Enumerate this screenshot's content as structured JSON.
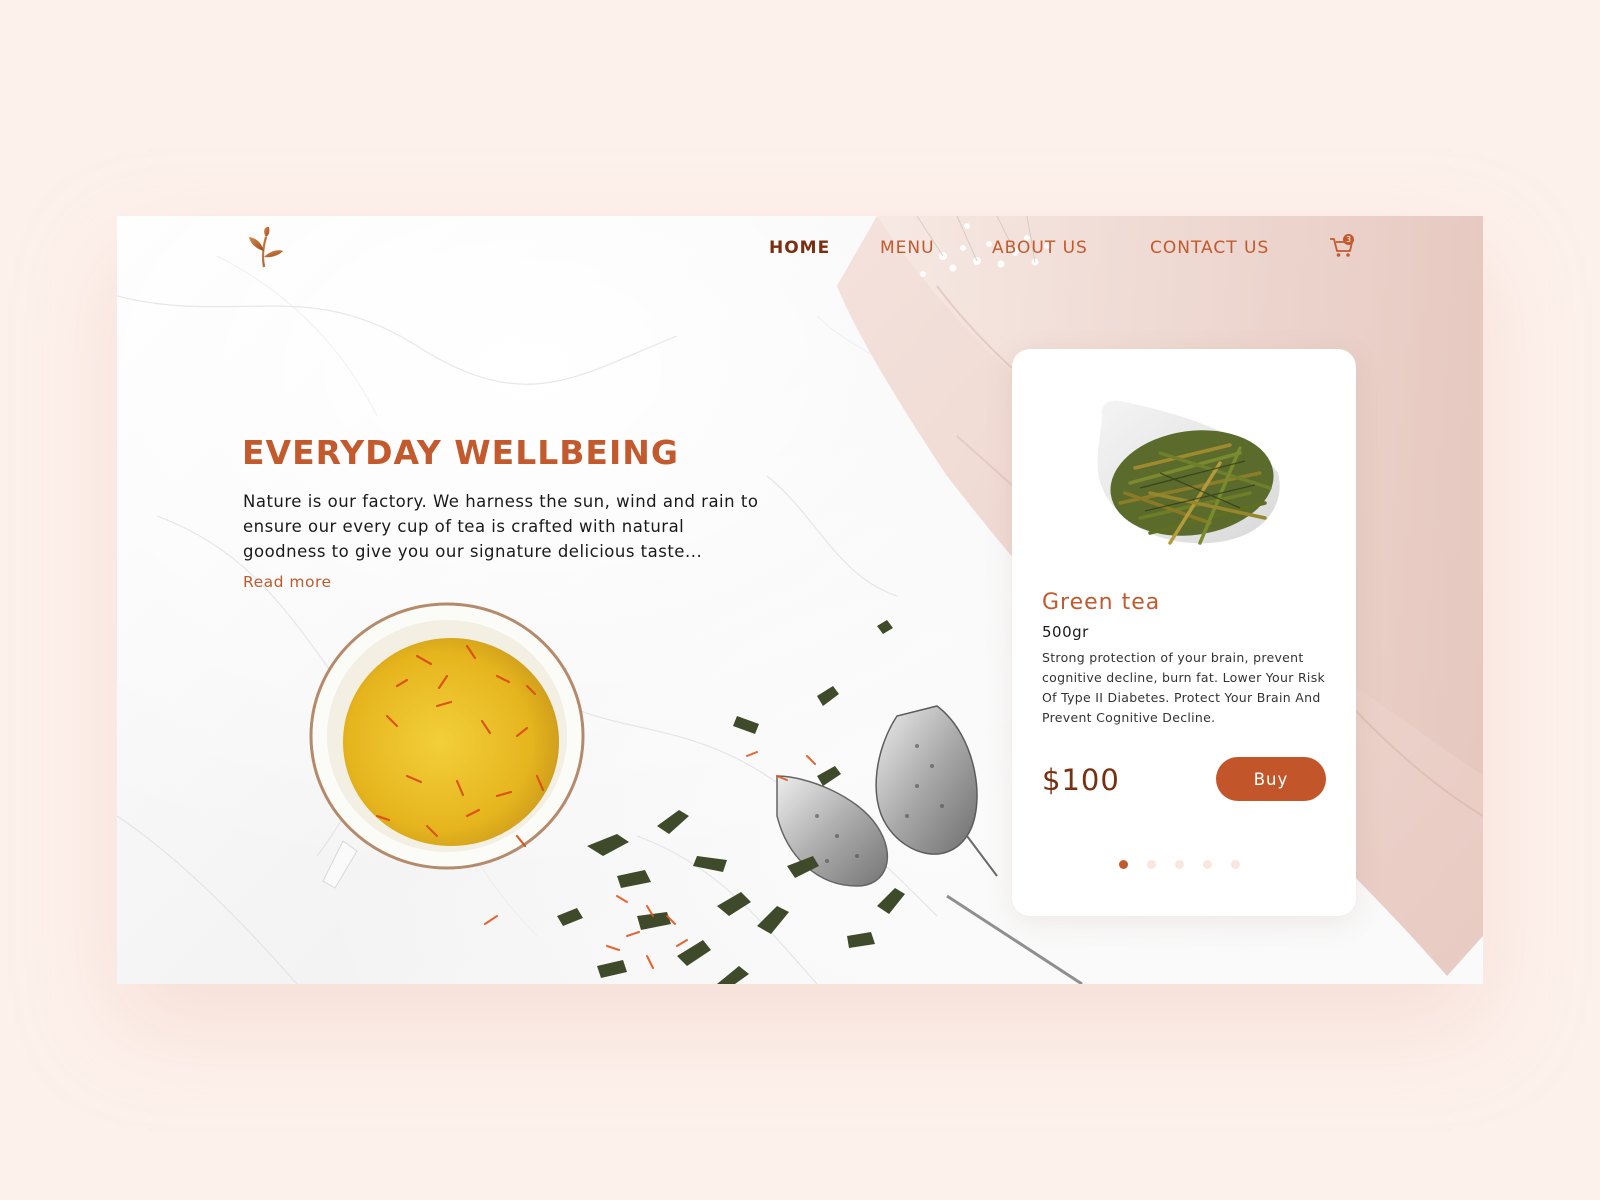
{
  "nav": {
    "items": [
      {
        "label": "HOME",
        "active": true
      },
      {
        "label": "MENU",
        "active": false
      },
      {
        "label": "ABOUT US",
        "active": false
      },
      {
        "label": "CONTACT US",
        "active": false
      }
    ],
    "cart_count": "3"
  },
  "hero": {
    "title": "EVERYDAY WELLBEING",
    "description": "Nature is our factory. We harness the sun, wind and rain to ensure our every cup of tea is crafted with natural goodness to give you our signature delicious taste...",
    "read_more": "Read more"
  },
  "product": {
    "name": "Green tea",
    "weight": "500gr",
    "description": "Strong protection of your brain, prevent cognitive decline, burn fat. Lower Your Risk Of Type II Diabetes. Protect Your Brain And Prevent Cognitive Decline.",
    "price": "$100",
    "buy_label": "Buy"
  },
  "carousel": {
    "total": 5,
    "active_index": 0
  },
  "colors": {
    "accent": "#c25a2d",
    "accent_dark": "#7a2f10",
    "page_background": "#fdf1ec",
    "dot_inactive": "#f9e6de"
  },
  "icons": [
    "tea-leaf-logo-icon",
    "shopping-cart-icon"
  ]
}
